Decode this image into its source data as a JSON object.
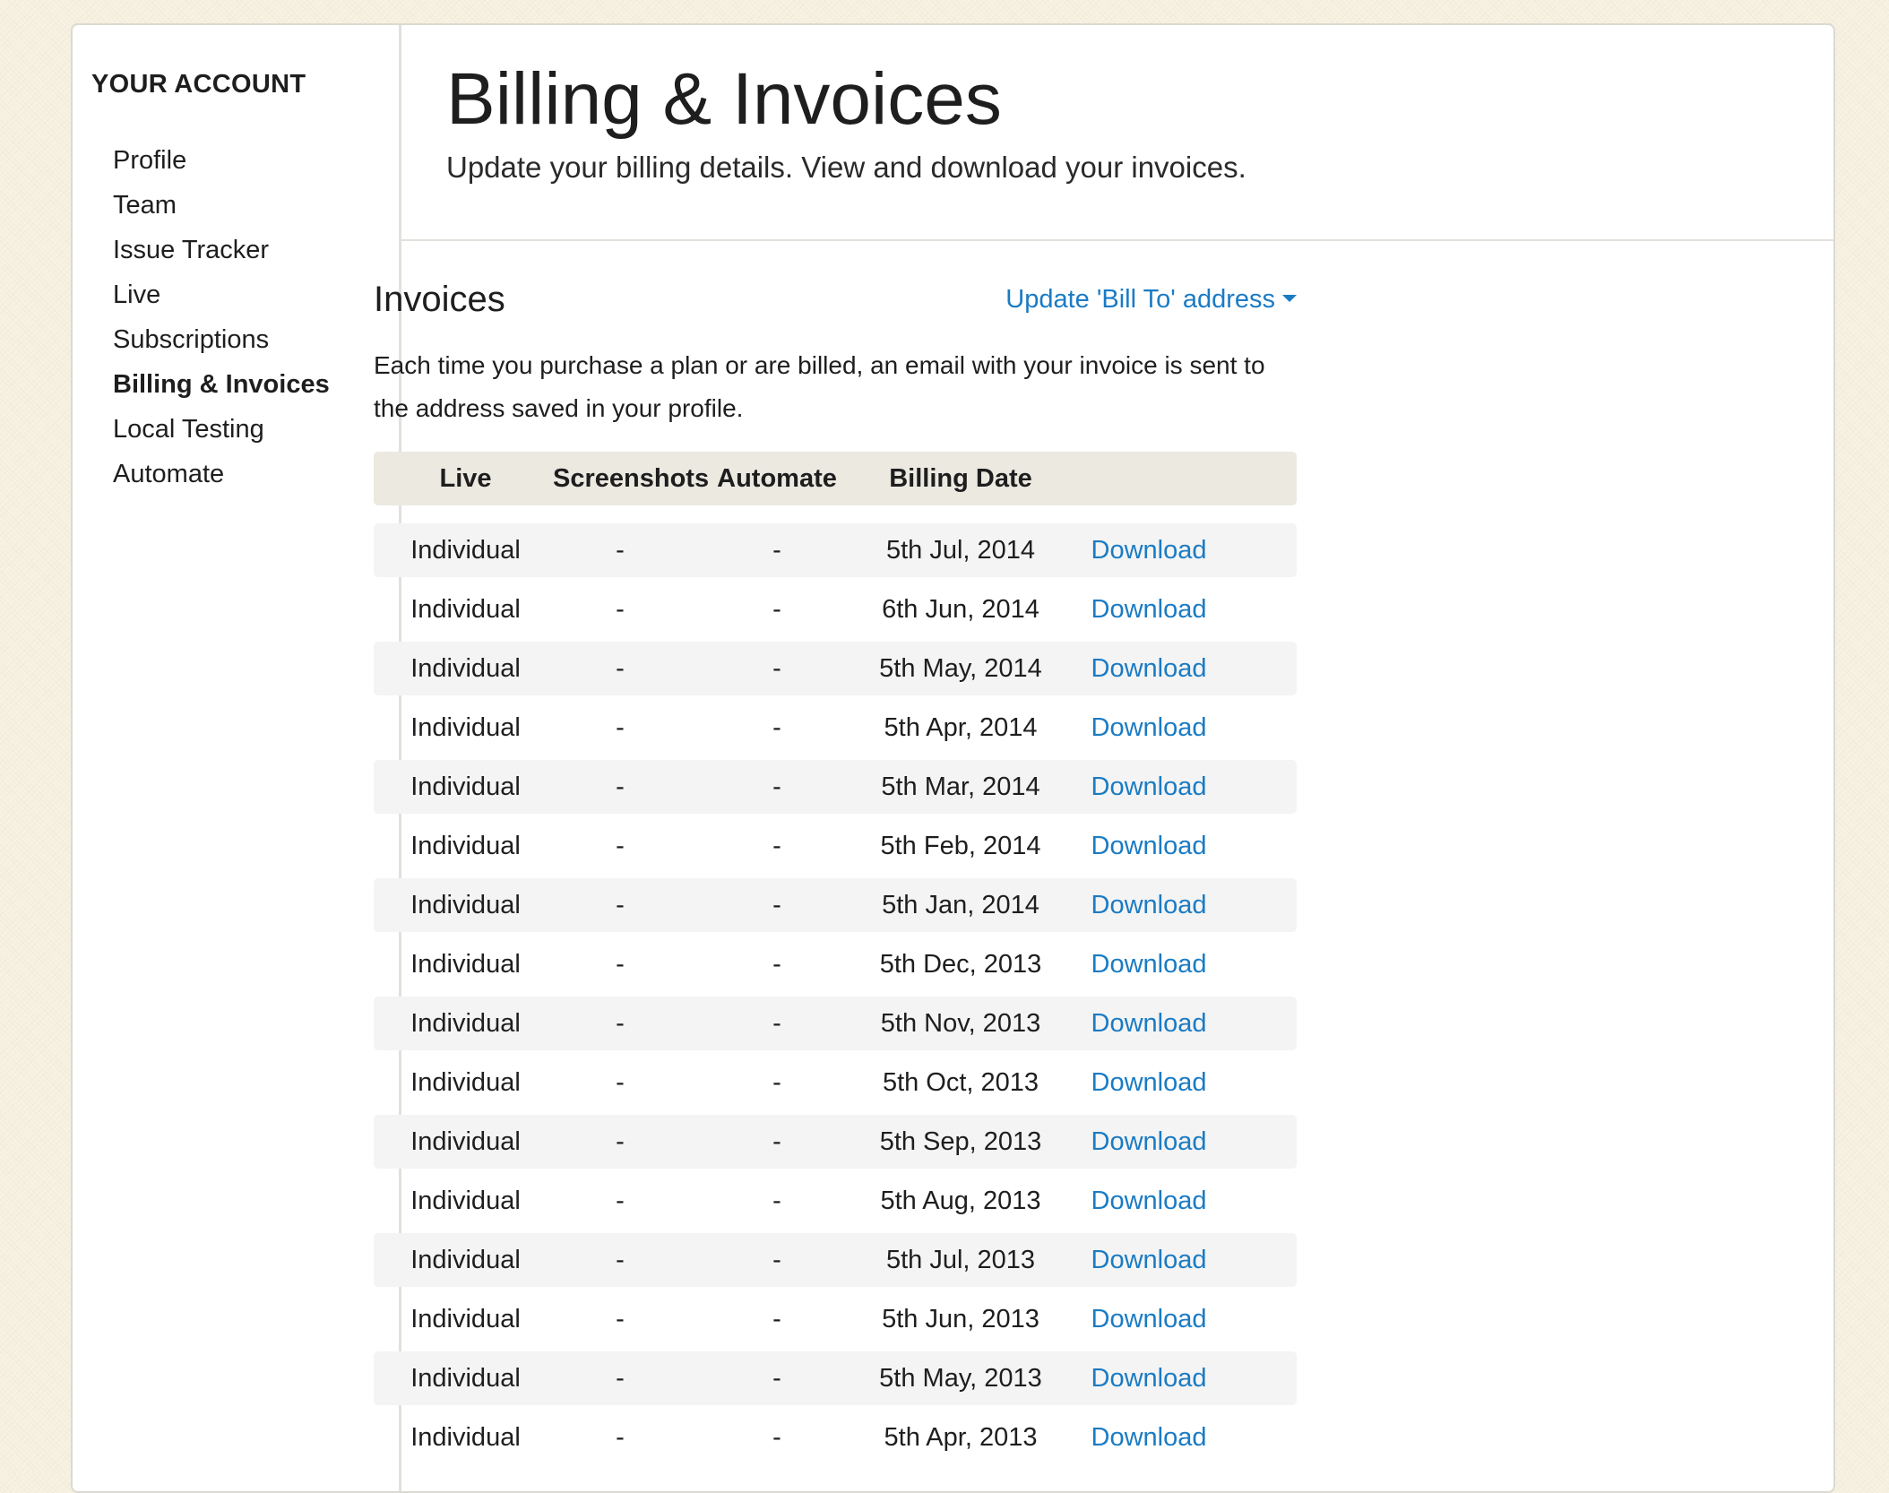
{
  "sidebar": {
    "heading": "YOUR ACCOUNT",
    "items": [
      {
        "label": "Profile",
        "active": false
      },
      {
        "label": "Team",
        "active": false
      },
      {
        "label": "Issue Tracker",
        "active": false
      },
      {
        "label": "Live",
        "active": false
      },
      {
        "label": "Subscriptions",
        "active": false
      },
      {
        "label": "Billing & Invoices",
        "active": true
      },
      {
        "label": "Local Testing",
        "active": false
      },
      {
        "label": "Automate",
        "active": false
      }
    ]
  },
  "header": {
    "title": "Billing & Invoices",
    "subtitle": "Update your billing details. View and download your invoices."
  },
  "invoices": {
    "title": "Invoices",
    "bill_to_link": "Update 'Bill To' address",
    "intro": "Each time you purchase a plan or are billed, an email with your invoice is sent to the address saved in your profile.",
    "columns": [
      "Live",
      "Screenshots",
      "Automate",
      "Billing Date",
      ""
    ],
    "rows": [
      {
        "live": "Individual",
        "screenshots": "-",
        "automate": "-",
        "date": "5th Jul, 2014",
        "action": "Download"
      },
      {
        "live": "Individual",
        "screenshots": "-",
        "automate": "-",
        "date": "6th Jun, 2014",
        "action": "Download"
      },
      {
        "live": "Individual",
        "screenshots": "-",
        "automate": "-",
        "date": "5th May, 2014",
        "action": "Download"
      },
      {
        "live": "Individual",
        "screenshots": "-",
        "automate": "-",
        "date": "5th Apr, 2014",
        "action": "Download"
      },
      {
        "live": "Individual",
        "screenshots": "-",
        "automate": "-",
        "date": "5th Mar, 2014",
        "action": "Download"
      },
      {
        "live": "Individual",
        "screenshots": "-",
        "automate": "-",
        "date": "5th Feb, 2014",
        "action": "Download"
      },
      {
        "live": "Individual",
        "screenshots": "-",
        "automate": "-",
        "date": "5th Jan, 2014",
        "action": "Download"
      },
      {
        "live": "Individual",
        "screenshots": "-",
        "automate": "-",
        "date": "5th Dec, 2013",
        "action": "Download"
      },
      {
        "live": "Individual",
        "screenshots": "-",
        "automate": "-",
        "date": "5th Nov, 2013",
        "action": "Download"
      },
      {
        "live": "Individual",
        "screenshots": "-",
        "automate": "-",
        "date": "5th Oct, 2013",
        "action": "Download"
      },
      {
        "live": "Individual",
        "screenshots": "-",
        "automate": "-",
        "date": "5th Sep, 2013",
        "action": "Download"
      },
      {
        "live": "Individual",
        "screenshots": "-",
        "automate": "-",
        "date": "5th Aug, 2013",
        "action": "Download"
      },
      {
        "live": "Individual",
        "screenshots": "-",
        "automate": "-",
        "date": "5th Jul, 2013",
        "action": "Download"
      },
      {
        "live": "Individual",
        "screenshots": "-",
        "automate": "-",
        "date": "5th Jun, 2013",
        "action": "Download"
      },
      {
        "live": "Individual",
        "screenshots": "-",
        "automate": "-",
        "date": "5th May, 2013",
        "action": "Download"
      },
      {
        "live": "Individual",
        "screenshots": "-",
        "automate": "-",
        "date": "5th Apr, 2013",
        "action": "Download"
      }
    ]
  },
  "colors": {
    "link": "#1a7bc4",
    "page_background": "#f7f2e3",
    "table_header": "#ece9e1",
    "row_stripe": "#f4f4f4"
  }
}
